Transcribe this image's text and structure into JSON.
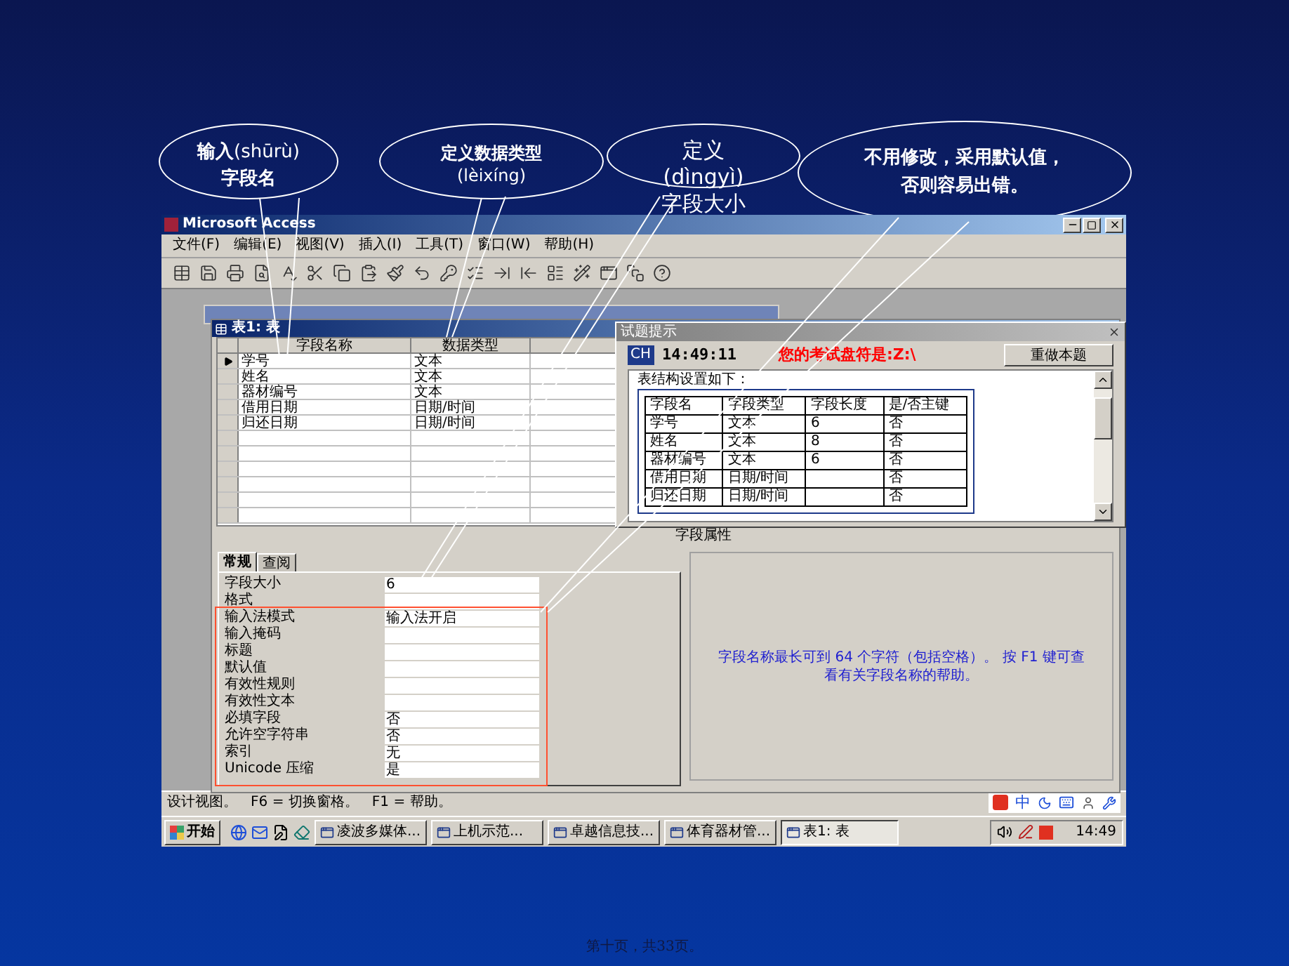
{
  "callouts": [
    {
      "lines": [
        "**输入**(shūrù)",
        "**字段名**"
      ]
    },
    {
      "lines": [
        "**定义数据类型**",
        "(lèixíng)"
      ]
    },
    {
      "lines": [
        "定义",
        "(dìngyì)",
        "字段大小"
      ]
    },
    {
      "lines": [
        "**不用修改，采用默认值，**",
        "**否则容易出错**。"
      ]
    }
  ],
  "app": {
    "title": "Microsoft Access",
    "menu": [
      "文件(F)",
      "编辑(E)",
      "视图(V)",
      "插入(I)",
      "工具(T)",
      "窗口(W)",
      "帮助(H)"
    ],
    "status_text": "设计视图。   F6 = 切换窗格。   F1 = 帮助。",
    "ime_mode": "中"
  },
  "table_window": {
    "title": "表1: 表",
    "columns": [
      "字段名称",
      "数据类型"
    ],
    "rows": [
      {
        "name": "学号",
        "type": "文本",
        "selected": true
      },
      {
        "name": "姓名",
        "type": "文本",
        "selected": false
      },
      {
        "name": "器材编号",
        "type": "文本",
        "selected": false
      },
      {
        "name": "借用日期",
        "type": "日期/时间",
        "selected": false
      },
      {
        "name": "归还日期",
        "type": "日期/时间",
        "selected": false
      }
    ],
    "properties_label": "字段属性",
    "tabs": [
      {
        "label": "常规",
        "selected": true
      },
      {
        "label": "查阅",
        "selected": false
      }
    ],
    "properties": [
      {
        "label": "字段大小",
        "value": "6"
      },
      {
        "label": "格式"
      },
      {
        "label": "输入法模式",
        "value": "输入法开启"
      },
      {
        "label": "输入掩码"
      },
      {
        "label": "标题"
      },
      {
        "label": "默认值"
      },
      {
        "label": "有效性规则"
      },
      {
        "label": "有效性文本"
      },
      {
        "label": "必填字段",
        "value": "否"
      },
      {
        "label": "允许空字符串",
        "value": "否"
      },
      {
        "label": "索引",
        "value": "无"
      },
      {
        "label": "Unicode 压缩",
        "value": "是"
      }
    ],
    "help_text": "字段名称最长可到 64 个字符（包括空格）。 按 F1 键可查看有关字段名称的帮助。"
  },
  "hint_dialog": {
    "title": "试题提示",
    "ime": "CH",
    "time": "14:49:11",
    "disk_text": "您的考试盘符是:Z:\\",
    "button": "重做本题",
    "intro": "表结构设置如下：",
    "columns": [
      "字段名",
      "字段类型",
      "字段长度",
      "是/否主键"
    ],
    "rows": [
      [
        "学号",
        "文本",
        "6",
        "否"
      ],
      [
        "姓名",
        "文本",
        "8",
        "否"
      ],
      [
        "器材编号",
        "文本",
        "6",
        "否"
      ],
      [
        "借用日期",
        "日期/时间",
        "",
        "否"
      ],
      [
        "归还日期",
        "日期/时间",
        "",
        "否"
      ]
    ]
  },
  "taskbar": {
    "start": "开始",
    "tasks": [
      {
        "label": "凌波多媒体...",
        "selected": false
      },
      {
        "label": "上机示范...",
        "selected": false
      },
      {
        "label": "卓越信息技...",
        "selected": false
      },
      {
        "label": "体育器材管...",
        "selected": false
      },
      {
        "label": "表1: 表",
        "selected": true
      }
    ],
    "clock": "14:49"
  },
  "footer": "第十页，共33页。"
}
